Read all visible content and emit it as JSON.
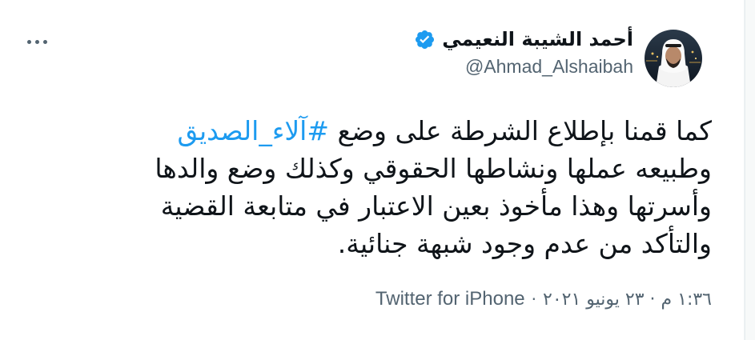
{
  "author": {
    "display_name": "أحمد الشيبة النعيمي",
    "handle": "@Ahmad_Alshaibah",
    "verified": true,
    "avatar_icon": "profile-photo"
  },
  "tweet": {
    "text_before_hashtag": "كما قمنا بإطلاع الشرطة على وضع ",
    "hashtag": "#آلاء_الصديق",
    "text_after_hashtag": "\nوطبيعه عملها ونشاطها الحقوقي وكذلك وضع والدها\nوأسرتها وهذا مأخوذ بعين الاعتبار في متابعة القضية\nوالتأكد من عدم وجود شبهة جنائية."
  },
  "meta": {
    "time_date": "١:٣٦ م · ٢٣ يونيو ٢٠٢١",
    "separator": "·",
    "source": "Twitter for iPhone"
  },
  "colors": {
    "link": "#1d9bf0",
    "text": "#0f1419",
    "secondary": "#536471",
    "verified_badge": "#1d9bf0"
  },
  "icons": {
    "more": "more-horizontal-icon",
    "verified": "verified-badge-icon"
  }
}
